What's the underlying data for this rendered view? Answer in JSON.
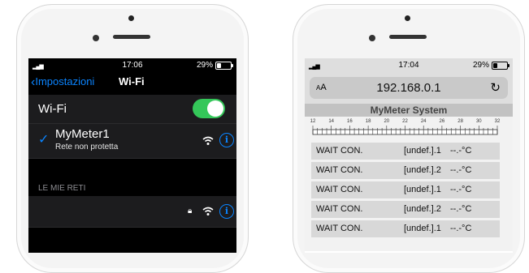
{
  "left_phone": {
    "status": {
      "time": "17:06",
      "battery": "29%",
      "battery_level": 0.29
    },
    "nav": {
      "back_label": "Impostazioni",
      "title": "Wi-Fi"
    },
    "wifi_row": {
      "label": "Wi-Fi",
      "enabled": true
    },
    "connected_network": {
      "name": "MyMeter1",
      "security": "Rete non protetta"
    },
    "section_header": "LE MIE RETI",
    "icons": {
      "check": "checkmark-icon",
      "wifi": "wifi-icon",
      "info": "info-icon",
      "lock": "lock-icon",
      "back": "chevron-left-icon"
    },
    "colors": {
      "accent": "#0a84ff",
      "toggle_on": "#34c759"
    }
  },
  "right_phone": {
    "status": {
      "time": "17:04",
      "battery": "29%",
      "battery_level": 0.29
    },
    "address_bar": {
      "text_size": "AA",
      "url": "192.168.0.1",
      "reload_icon": "reload-icon"
    },
    "page": {
      "title": "MyMeter System",
      "scale_labels": [
        "12",
        "14",
        "16",
        "18",
        "20",
        "22",
        "24",
        "26",
        "28",
        "30",
        "32"
      ],
      "readings": [
        {
          "status": "WAIT CON.",
          "sensor": "[undef.].1",
          "temp": "--.-°C"
        },
        {
          "status": "WAIT CON.",
          "sensor": "[undef.].2",
          "temp": "--.-°C"
        },
        {
          "status": "WAIT CON.",
          "sensor": "[undef.].1",
          "temp": "--.-°C"
        },
        {
          "status": "WAIT CON.",
          "sensor": "[undef.].2",
          "temp": "--.-°C"
        },
        {
          "status": "WAIT CON.",
          "sensor": "[undef.].1",
          "temp": "--.-°C"
        }
      ]
    }
  }
}
